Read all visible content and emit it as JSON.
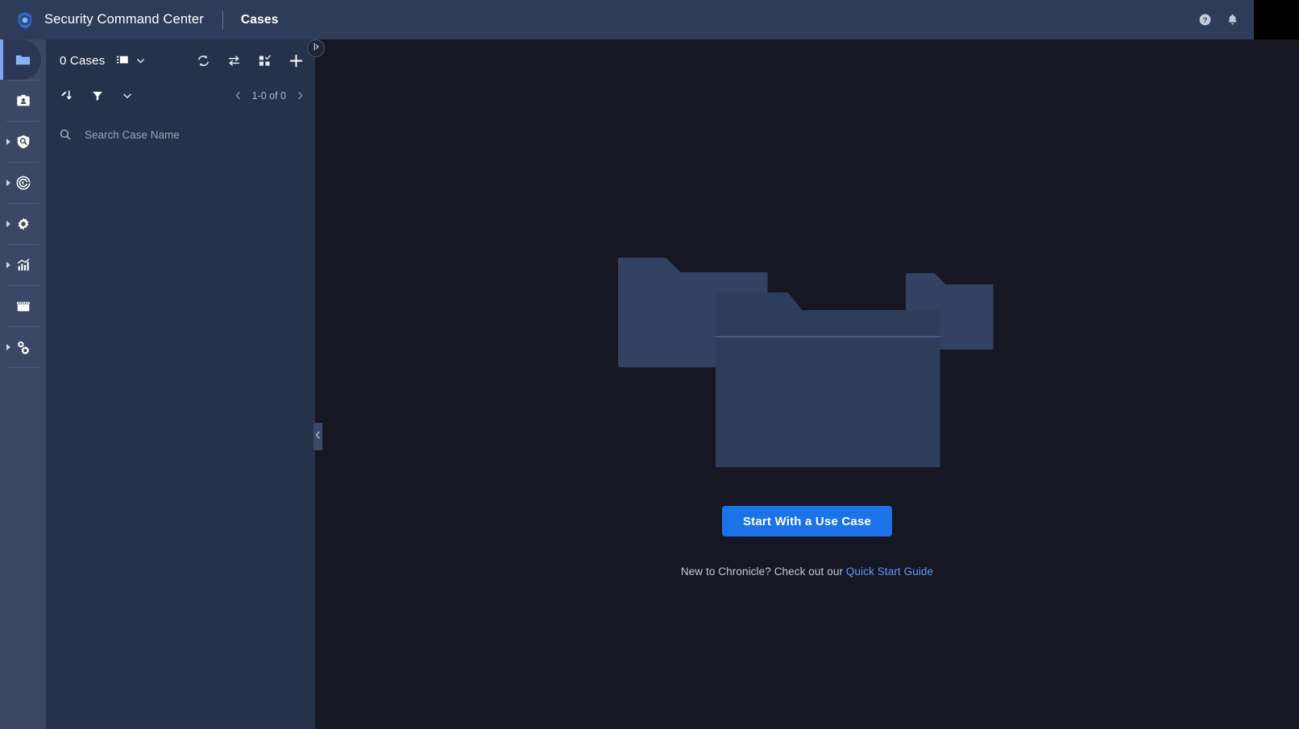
{
  "header": {
    "product_name": "Security Command Center",
    "section": "Cases",
    "logo_icon": "shield-logo-icon",
    "help_icon": "help-circle-icon",
    "notifications_icon": "bell-icon",
    "avatar": "avatar-placeholder"
  },
  "colors": {
    "header_bg": "#2e3b59",
    "rail_bg": "#3b4764",
    "panel_bg": "#26324a",
    "main_bg": "#171723",
    "accent_blue": "#1a73e8",
    "link_blue": "#5b9bf8",
    "active_icon": "#8ab4f8",
    "folder_back": "#334263",
    "folder_front": "#2f3d5d"
  },
  "sidebar": {
    "items": [
      {
        "name": "cases",
        "icon": "folder-icon",
        "label": "Cases",
        "active": true,
        "expandable": false
      },
      {
        "name": "profiles",
        "icon": "id-badge-icon",
        "label": "Profiles",
        "active": false,
        "expandable": false
      },
      {
        "name": "detection",
        "icon": "shield-search-icon",
        "label": "Detection",
        "active": false,
        "expandable": true
      },
      {
        "name": "response",
        "icon": "radar-target-icon",
        "label": "Response",
        "active": false,
        "expandable": true
      },
      {
        "name": "settings",
        "icon": "gear-icon",
        "label": "Settings",
        "active": false,
        "expandable": true
      },
      {
        "name": "reports",
        "icon": "bar-chart-icon",
        "label": "Reports",
        "active": false,
        "expandable": true
      },
      {
        "name": "marketplace",
        "icon": "storefront-icon",
        "label": "Marketplace",
        "active": false,
        "expandable": false
      },
      {
        "name": "admin",
        "icon": "multi-gear-icon",
        "label": "Administration",
        "active": false,
        "expandable": true
      }
    ]
  },
  "cases_panel": {
    "count_label": "0 Cases",
    "view_toggle_icon": "split-view-icon",
    "view_toggle_chevron": "chevron-down-icon",
    "actions": [
      {
        "name": "refresh",
        "icon": "refresh-icon"
      },
      {
        "name": "swap",
        "icon": "swap-arrows-icon"
      },
      {
        "name": "bulk-select",
        "icon": "checkbox-grid-icon"
      },
      {
        "name": "add-case",
        "icon": "plus-icon"
      }
    ],
    "filter_row": [
      {
        "name": "sort",
        "icon": "sort-arrow-icon"
      },
      {
        "name": "filter",
        "icon": "funnel-icon"
      },
      {
        "name": "more-filters",
        "icon": "chevron-down-icon"
      }
    ],
    "pagination": {
      "prev_icon": "chevron-left-icon",
      "range_text": "1-0 of 0",
      "next_icon": "chevron-right-icon"
    },
    "search": {
      "icon": "search-icon",
      "placeholder": "Search Case Name",
      "value": ""
    },
    "expand_handle_icon": "panel-expand-icon",
    "collapse_handle_icon": "chevron-left-icon"
  },
  "empty_state": {
    "illustration": "stacked-folders-illustration",
    "primary_button": "Start With a Use Case",
    "hint_prefix": "New to Chronicle? Check out our ",
    "hint_link": "Quick Start Guide"
  }
}
